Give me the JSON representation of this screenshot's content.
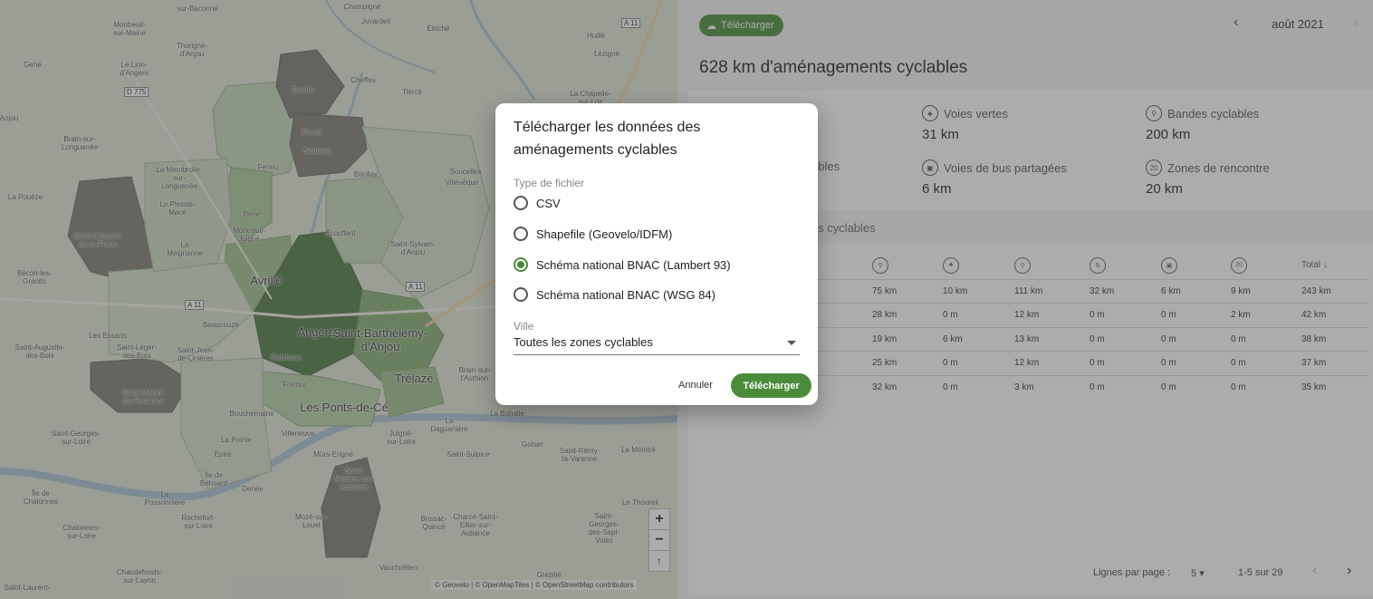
{
  "map": {
    "places": [
      {
        "name": "Montreuil-sur-Maine",
        "lines": [
          "Montreuil-",
          "sur-Maine"
        ]
      },
      {
        "name": "Thorigné-d'Anjou",
        "lines": [
          "Thorigné-",
          "d'Anjou"
        ]
      },
      {
        "name": "Juvardeil",
        "lines": [
          "Juvardeil"
        ]
      },
      {
        "name": "Étriché",
        "lines": [
          "Étriché"
        ]
      },
      {
        "name": "Huillé",
        "lines": [
          "Huillé"
        ]
      },
      {
        "name": "Lézigné",
        "lines": [
          "Lézigné"
        ]
      },
      {
        "name": "Gené",
        "lines": [
          "Gené"
        ]
      },
      {
        "name": "Le Lion-d'Angers",
        "lines": [
          "Le Lion-",
          "d'Angers"
        ]
      },
      {
        "name": "Écuillé",
        "lines": [
          "Écuillé"
        ]
      },
      {
        "name": "Cheffes",
        "lines": [
          "Cheffes"
        ]
      },
      {
        "name": "Tiercé",
        "lines": [
          "Tiercé"
        ]
      },
      {
        "name": "La Chapelle-Saint-Laud",
        "lines": [
          "La Chapelle-",
          "sur-Loir"
        ]
      },
      {
        "name": "Anjou",
        "lines": [
          "Anjou"
        ]
      },
      {
        "name": "Brain-sur-Longuenée",
        "lines": [
          "Brain-sur-",
          "Longuenée"
        ]
      },
      {
        "name": "Bourg",
        "lines": [
          "Bourg"
        ]
      },
      {
        "name": "Soulaire",
        "lines": [
          "Soulaire"
        ]
      },
      {
        "name": "Feneu",
        "lines": [
          "Feneu"
        ]
      },
      {
        "name": "Briollay",
        "lines": [
          "Briollay"
        ]
      },
      {
        "name": "Soucelles",
        "lines": [
          "Soucelles"
        ]
      },
      {
        "name": "Villévêque",
        "lines": [
          "Villévêque"
        ]
      },
      {
        "name": "La Membrolle-sur-Longuenée",
        "lines": [
          "La Membrolle-",
          "sur-",
          "Longuenée"
        ]
      },
      {
        "name": "La Pouëze",
        "lines": [
          "La Pouëze"
        ]
      },
      {
        "name": "Le Plessis-Macé",
        "lines": [
          "Le Plessis-",
          "Macé"
        ]
      },
      {
        "name": "Béné",
        "lines": [
          "Béné"
        ]
      },
      {
        "name": "Montreuil-Juigné",
        "lines": [
          "Montreuil-",
          "Juigné"
        ]
      },
      {
        "name": "Écouflant",
        "lines": [
          "Écouflant"
        ]
      },
      {
        "name": "Saint-Sylvain-d'Anjou",
        "lines": [
          "Saint-Sylvain-",
          "d'Anjou"
        ]
      },
      {
        "name": "Saint-Clément-de-la-Place",
        "lines": [
          "Saint-Clément-",
          "de-la-Place"
        ]
      },
      {
        "name": "La Meignanne",
        "lines": [
          "La",
          "Meignanne"
        ]
      },
      {
        "name": "Bécon-les-Granits",
        "lines": [
          "Bécon-les-",
          "Granits"
        ]
      },
      {
        "name": "Beaucouzé",
        "lines": [
          "Beaucouzé"
        ]
      },
      {
        "name": "Les Essarts",
        "lines": [
          "Les Essarts"
        ]
      },
      {
        "name": "Saint-Augustin-des-Bois",
        "lines": [
          "Saint-Augustin-",
          "des-Bois"
        ]
      },
      {
        "name": "Saint-Léger-des-Bois",
        "lines": [
          "Saint-Léger-",
          "des-Bois"
        ]
      },
      {
        "name": "Saint-Jean-de-Linières",
        "lines": [
          "Saint-Jean-",
          "de-Linières"
        ]
      },
      {
        "name": "Robinson",
        "lines": [
          "Robinson"
        ]
      },
      {
        "name": "Brain-sur-l'Authion",
        "lines": [
          "Brain-sur-",
          "l'Authion"
        ]
      },
      {
        "name": "Saint-Martin-du-Fouilloux",
        "lines": [
          "Saint-Martin-",
          "du-Fouilloux"
        ]
      },
      {
        "name": "Frémur",
        "lines": [
          "Frémur"
        ]
      },
      {
        "name": "Bouchemaine",
        "lines": [
          "Bouchemaine"
        ]
      },
      {
        "name": "La Daguenière",
        "lines": [
          "La",
          "Daguenière"
        ]
      },
      {
        "name": "La Bohalle",
        "lines": [
          "La Bohalle"
        ]
      },
      {
        "name": "Saint-Georges-sur-Loire",
        "lines": [
          "Saint-Georges-",
          "sur-Loire"
        ]
      },
      {
        "name": "La Pointe",
        "lines": [
          "La Pointe"
        ]
      },
      {
        "name": "Villeneuve",
        "lines": [
          "Villeneuve"
        ]
      },
      {
        "name": "Juigné-sur-Loire",
        "lines": [
          "Juigné-",
          "sur-Loire"
        ]
      },
      {
        "name": "Gohier",
        "lines": [
          "Gohier"
        ]
      },
      {
        "name": "La Ménitré",
        "lines": [
          "La Ménitré"
        ]
      },
      {
        "name": "Épiré",
        "lines": [
          "Épiré"
        ]
      },
      {
        "name": "Mûrs-Erigné",
        "lines": [
          "Mûrs-Erigné"
        ]
      },
      {
        "name": "Saint-Sulpice",
        "lines": [
          "Saint-Sulpice"
        ]
      },
      {
        "name": "Saint-Rémy-la-Varenne",
        "lines": [
          "Saint-Rémy-",
          "la-Varenne"
        ]
      },
      {
        "name": "Île de Béhuard",
        "lines": [
          "Île de",
          "Béhuard"
        ]
      },
      {
        "name": "Denée",
        "lines": [
          "Denée"
        ]
      },
      {
        "name": "Île de Chalonnes",
        "lines": [
          "Île de",
          "Chalonnes"
        ]
      },
      {
        "name": "La Possonnière",
        "lines": [
          "La",
          "Possonnière"
        ]
      },
      {
        "name": "Saint-Melaine-sur-Aubance",
        "lines": [
          "Saint-",
          "Melaine-sur-",
          "Aubance"
        ]
      },
      {
        "name": "Le Thoureil",
        "lines": [
          "Le Thoureil"
        ]
      },
      {
        "name": "Rochefort-sur-Loire",
        "lines": [
          "Rochefort-",
          "sur-Loire"
        ]
      },
      {
        "name": "Brissac-Quincé",
        "lines": [
          "Brissac-",
          "Quincé"
        ]
      },
      {
        "name": "Charcé-Saint-Ellier-sur-Aubance",
        "lines": [
          "Charcé-Saint-",
          "Ellier-sur-",
          "Aubance"
        ]
      },
      {
        "name": "Saint-Georges-des-Sept-Voies",
        "lines": [
          "Saint-",
          "Georges-",
          "des-Sept-",
          "Voies"
        ]
      },
      {
        "name": "Chalonnes-sur-Loire",
        "lines": [
          "Chalonnes-",
          "sur-Loire"
        ]
      },
      {
        "name": "Mozé-sur-Louet",
        "lines": [
          "Mozé-sur-",
          "Louet"
        ]
      },
      {
        "name": "Chaudefonds-sur-Layon",
        "lines": [
          "Chaudefonds-",
          "sur-Layon"
        ]
      },
      {
        "name": "Vauchrétien",
        "lines": [
          "Vauchrétien"
        ]
      },
      {
        "name": "Grézillé",
        "lines": [
          "Grézillé"
        ]
      },
      {
        "name": "Saint-Laurent",
        "lines": [
          "Saint-Laurent-"
        ]
      },
      {
        "name": "Champigné",
        "lines": [
          "Champigné"
        ]
      },
      {
        "name": "sur-Baconne",
        "lines": [
          "sur-Baconne"
        ]
      }
    ],
    "big_places": [
      "Avrillé",
      "Angers",
      "Saint-Barthélemy-d'Anjou",
      "Trélazé",
      "Les Ponts-de-Cé"
    ],
    "roads": [
      "A 11",
      "D 775",
      "A 11",
      "A 11"
    ],
    "zoom_in": "+",
    "zoom_out": "−",
    "reset": "↑",
    "attribution": "© Geovelo | © OpenMapTiles | © OpenStreetMap contributors"
  },
  "topbar": {
    "download_label": "Télécharger",
    "month": "août 2021"
  },
  "summary": {
    "title": "628 km d'aménagements cyclables",
    "stats": [
      {
        "label": "Voies vertes",
        "value": "31 km",
        "icon": "tree-icon"
      },
      {
        "label": "Bandes cyclables",
        "value": "200 km",
        "icon": "bike-lane-icon"
      },
      {
        "label": "ables",
        "value": "",
        "icon": ""
      },
      {
        "label": "Voies de bus partagées",
        "value": "6 km",
        "icon": "bus-icon"
      },
      {
        "label": "Zones de rencontre",
        "value": "20 km",
        "icon": "zone-20-icon"
      }
    ]
  },
  "table": {
    "section_title": "ents cyclables",
    "total_header": "Total ↓",
    "rows": [
      [
        "75 km",
        "10 km",
        "111 km",
        "32 km",
        "6 km",
        "9 km",
        "243 km"
      ],
      [
        "28 km",
        "0 m",
        "12 km",
        "0 m",
        "0 m",
        "2 km",
        "42 km"
      ],
      [
        "19 km",
        "6 km",
        "13 km",
        "0 m",
        "0 m",
        "0 m",
        "38 km"
      ],
      [
        "25 km",
        "0 m",
        "12 km",
        "0 m",
        "0 m",
        "0 m",
        "37 km"
      ],
      [
        "32 km",
        "0 m",
        "3 km",
        "0 m",
        "0 m",
        "0 m",
        "35 km"
      ]
    ],
    "rows_per_page_label": "Lignes par page :",
    "rows_per_page": "5",
    "range": "1-5 sur 29"
  },
  "dialog": {
    "title": "Télécharger les données des aménagements cyclables",
    "file_type_label": "Type de fichier",
    "options": [
      {
        "label": "CSV",
        "selected": false
      },
      {
        "label": "Shapefile (Geovelo/IDFM)",
        "selected": false
      },
      {
        "label": "Schéma national BNAC (Lambert 93)",
        "selected": true
      },
      {
        "label": "Schéma national BNAC (WSG 84)",
        "selected": false
      }
    ],
    "city_label": "Ville",
    "city_value": "Toutes les zones cyclables",
    "cancel": "Annuler",
    "confirm": "Télécharger"
  },
  "colors": {
    "accent": "#4a8c3a",
    "overlay": "#464646"
  }
}
